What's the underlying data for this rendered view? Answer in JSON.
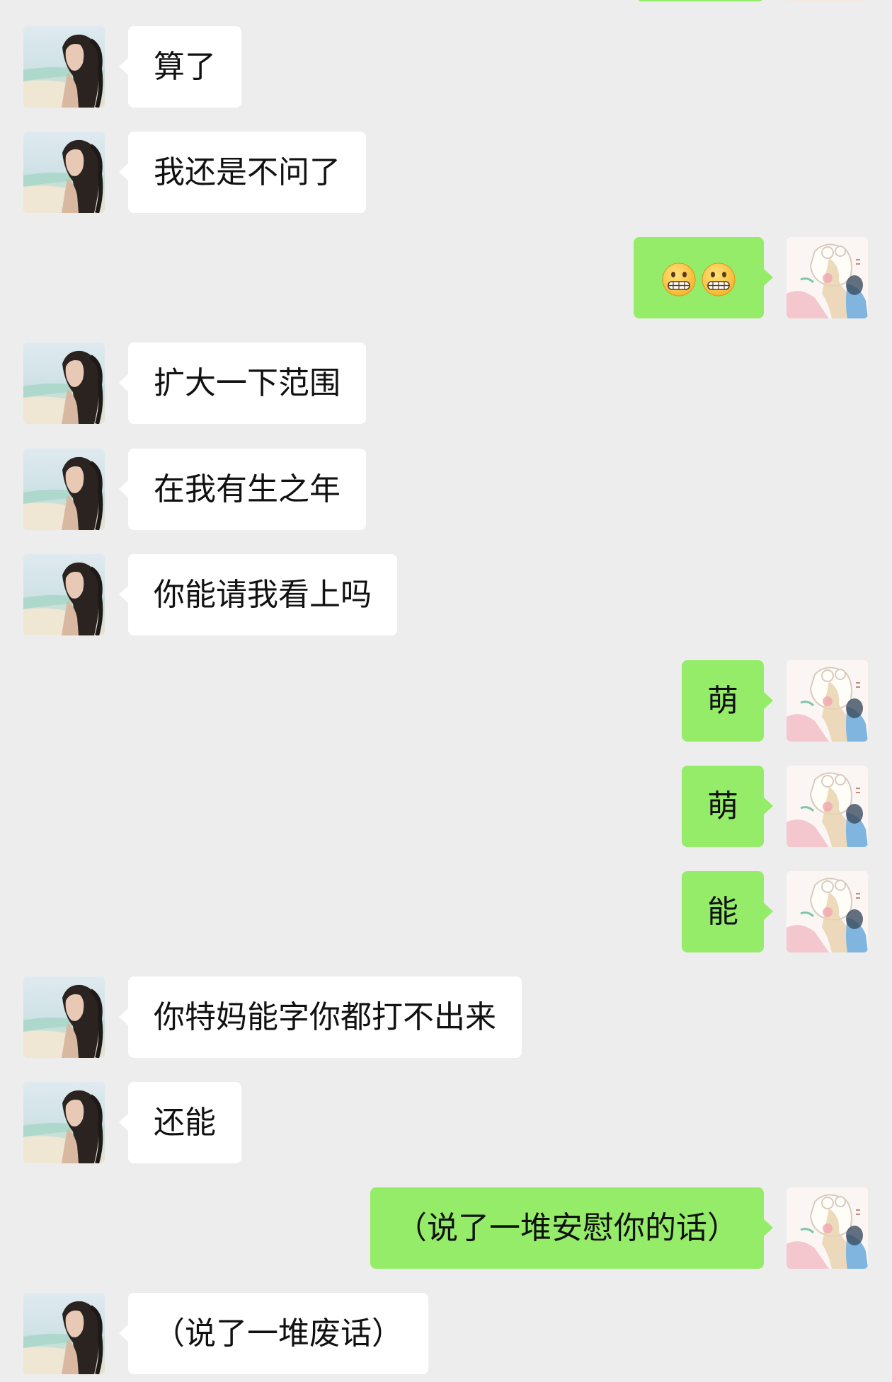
{
  "colors": {
    "background": "#ededed",
    "incoming_bubble": "#ffffff",
    "outgoing_bubble": "#95ec69",
    "text": "#111111"
  },
  "messages": [
    {
      "side": "left",
      "text": "算了"
    },
    {
      "side": "left",
      "text": "我还是不问了"
    },
    {
      "side": "right",
      "emoji": [
        "grimacing-face",
        "grimacing-face"
      ]
    },
    {
      "side": "left",
      "text": "扩大一下范围"
    },
    {
      "side": "left",
      "text": "在我有生之年"
    },
    {
      "side": "left",
      "text": "你能请我看上吗"
    },
    {
      "side": "right",
      "text": "萌"
    },
    {
      "side": "right",
      "text": "萌"
    },
    {
      "side": "right",
      "text": "能"
    },
    {
      "side": "left",
      "text": "你特妈能字你都打不出来"
    },
    {
      "side": "left",
      "text": "还能"
    },
    {
      "side": "right",
      "text": "（说了一堆安慰你的话）"
    },
    {
      "side": "left",
      "text": "（说了一堆废话）"
    }
  ]
}
